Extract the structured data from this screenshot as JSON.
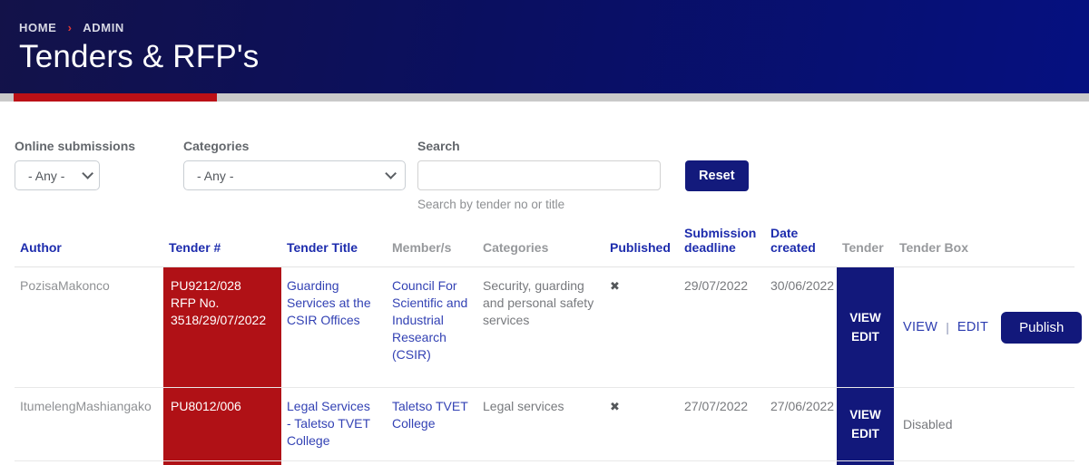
{
  "breadcrumb": {
    "items": [
      {
        "label": "HOME"
      },
      {
        "label": "ADMIN"
      }
    ],
    "separator": "›"
  },
  "header": {
    "title": "Tenders & RFP's"
  },
  "filters": {
    "online_submissions": {
      "label": "Online submissions",
      "selected": "- Any -"
    },
    "categories": {
      "label": "Categories",
      "selected": "- Any -"
    },
    "search": {
      "label": "Search",
      "value": "",
      "help_text": "Search by tender no or title"
    },
    "reset_button": "Reset"
  },
  "table": {
    "columns": [
      {
        "label": "Author",
        "sortable": true
      },
      {
        "label": "Tender #",
        "sortable": true
      },
      {
        "label": "Tender Title",
        "sortable": true
      },
      {
        "label": "Member/s",
        "sortable": false
      },
      {
        "label": "Categories",
        "sortable": false
      },
      {
        "label": "Published",
        "sortable": true
      },
      {
        "label": "Submission deadline",
        "sortable": true
      },
      {
        "label": "Date created",
        "sortable": true
      },
      {
        "label": "Tender",
        "sortable": false
      },
      {
        "label": "Tender Box",
        "sortable": false
      }
    ],
    "rows": [
      {
        "author": "PozisaMakonco",
        "tender_no": "PU9212/028\nRFP No.\n3518/29/07/2022",
        "tender_title": "Guarding Services at the CSIR Offices",
        "members": "Council For Scientific and Industrial Research (CSIR)",
        "categories": "Security, guarding and personal safety services",
        "published": "no",
        "published_icon": "✖",
        "submission_deadline": "29/07/2022",
        "date_created": "30/06/2022",
        "tender": {
          "view": "VIEW",
          "edit": "EDIT"
        },
        "tender_box": {
          "view": "VIEW",
          "divider": "|",
          "edit": "EDIT",
          "publish_button": "Publish"
        }
      },
      {
        "author": "ItumelengMashiangako",
        "tender_no": "PU8012/006",
        "tender_title": "Legal Services - Taletso TVET College",
        "members": "Taletso TVET College",
        "categories": "Legal services",
        "published": "no",
        "published_icon": "✖",
        "submission_deadline": "27/07/2022",
        "date_created": "27/06/2022",
        "tender": {
          "view": "VIEW",
          "edit": "EDIT"
        },
        "tender_box": {
          "status": "Disabled"
        }
      }
    ]
  },
  "colors": {
    "header_gradient_start": "#131249",
    "header_gradient_end": "#051080",
    "accent_red": "#b01116",
    "accent_navy": "#12187b",
    "link_blue": "#3342b4",
    "sort_header_blue": "#1d2cad",
    "strip_gray": "#c9c9c9"
  }
}
